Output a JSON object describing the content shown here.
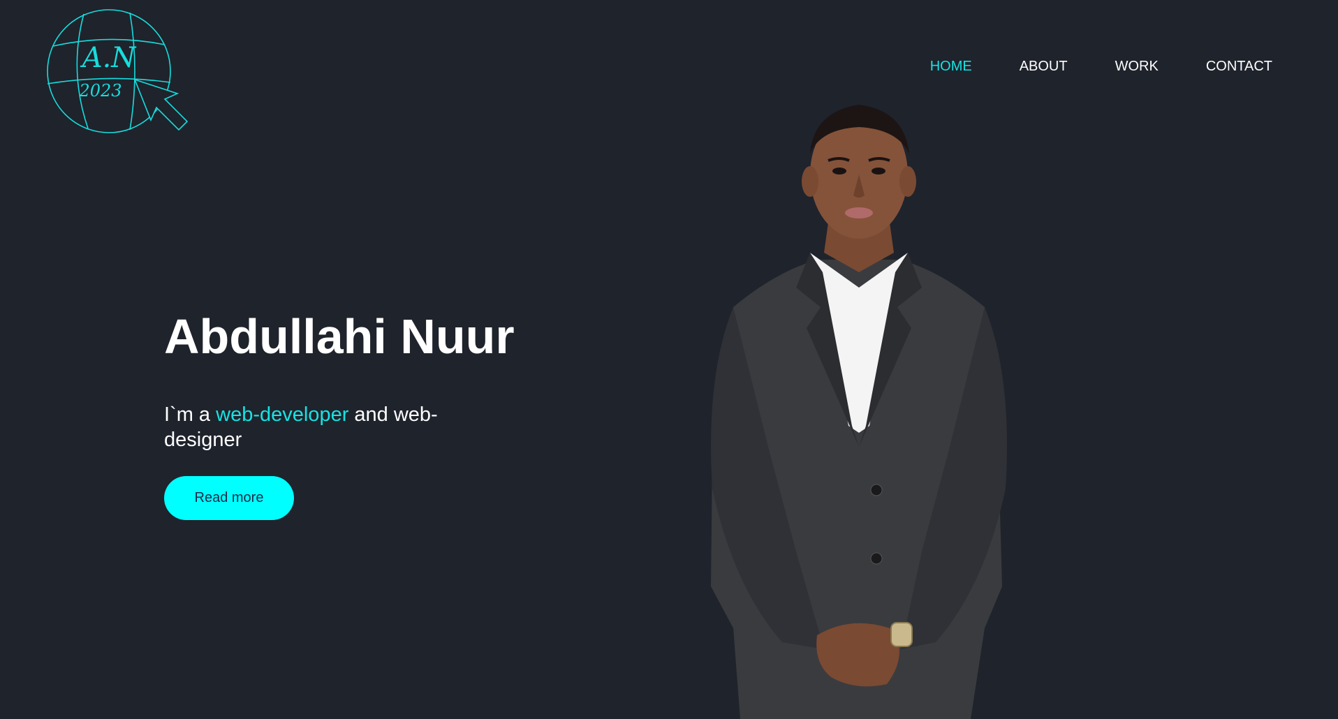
{
  "logo": {
    "initials": "A.N",
    "year": "2023"
  },
  "nav": {
    "items": [
      {
        "label": "HOME",
        "active": true
      },
      {
        "label": "ABOUT",
        "active": false
      },
      {
        "label": "WORK",
        "active": false
      },
      {
        "label": "CONTACT",
        "active": false
      }
    ]
  },
  "hero": {
    "name": "Abdullahi Nuur",
    "subtitle_prefix": "I`m a ",
    "subtitle_accent": "web-developer",
    "subtitle_suffix": " and web-designer",
    "button_label": "Read more"
  },
  "colors": {
    "background": "#1f232c",
    "accent": "#16e3e3",
    "button": "#00ffff"
  }
}
